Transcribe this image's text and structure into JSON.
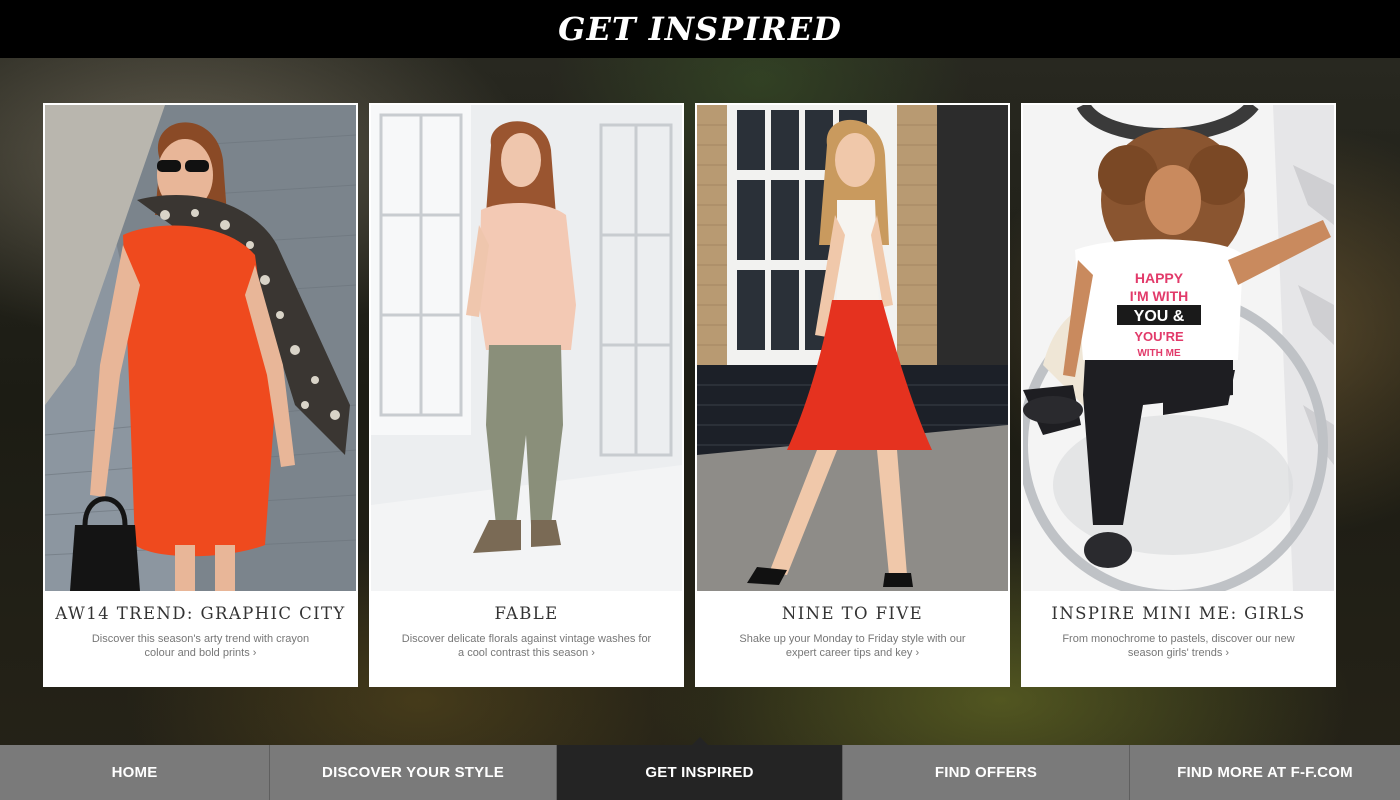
{
  "header": {
    "title": "GET INSPIRED"
  },
  "cards": [
    {
      "title": "AW14 TREND: GRAPHIC CITY",
      "description": "Discover this season's arty trend with crayon colour and bold prints ›",
      "image": "woman in orange dress with leopard scarf walking on cobblestone street"
    },
    {
      "title": "FABLE",
      "description": "Discover delicate florals against vintage washes for a cool contrast this season ›",
      "image": "girl in peach top and khaki trousers leaning on white window wall"
    },
    {
      "title": "NINE TO FIVE",
      "description": "Shake up your Monday to Friday style with our expert career tips and key ›",
      "image": "woman in white top and red skirt walking past brick building"
    },
    {
      "title": "INSPIRE MINI ME: GIRLS",
      "description": "From monochrome to pastels, discover our new season girls' trends ›",
      "image": "girl in slogan t-shirt sitting in clear acrylic chair",
      "shirt_text": [
        "HAPPY",
        "I'M WITH",
        "YOU &",
        "YOU'RE",
        "WITH ME"
      ]
    }
  ],
  "nav": {
    "items": [
      {
        "label": "HOME",
        "active": false
      },
      {
        "label": "DISCOVER YOUR STYLE",
        "active": false
      },
      {
        "label": "GET INSPIRED",
        "active": true
      },
      {
        "label": "FIND OFFERS",
        "active": false
      },
      {
        "label": "FIND MORE AT F-F.COM",
        "active": false
      }
    ]
  },
  "colors": {
    "header_bg": "#000000",
    "nav_bg": "#7a7a7a",
    "nav_active_bg": "#242424",
    "card_title": "#333333",
    "card_desc": "#777777"
  }
}
